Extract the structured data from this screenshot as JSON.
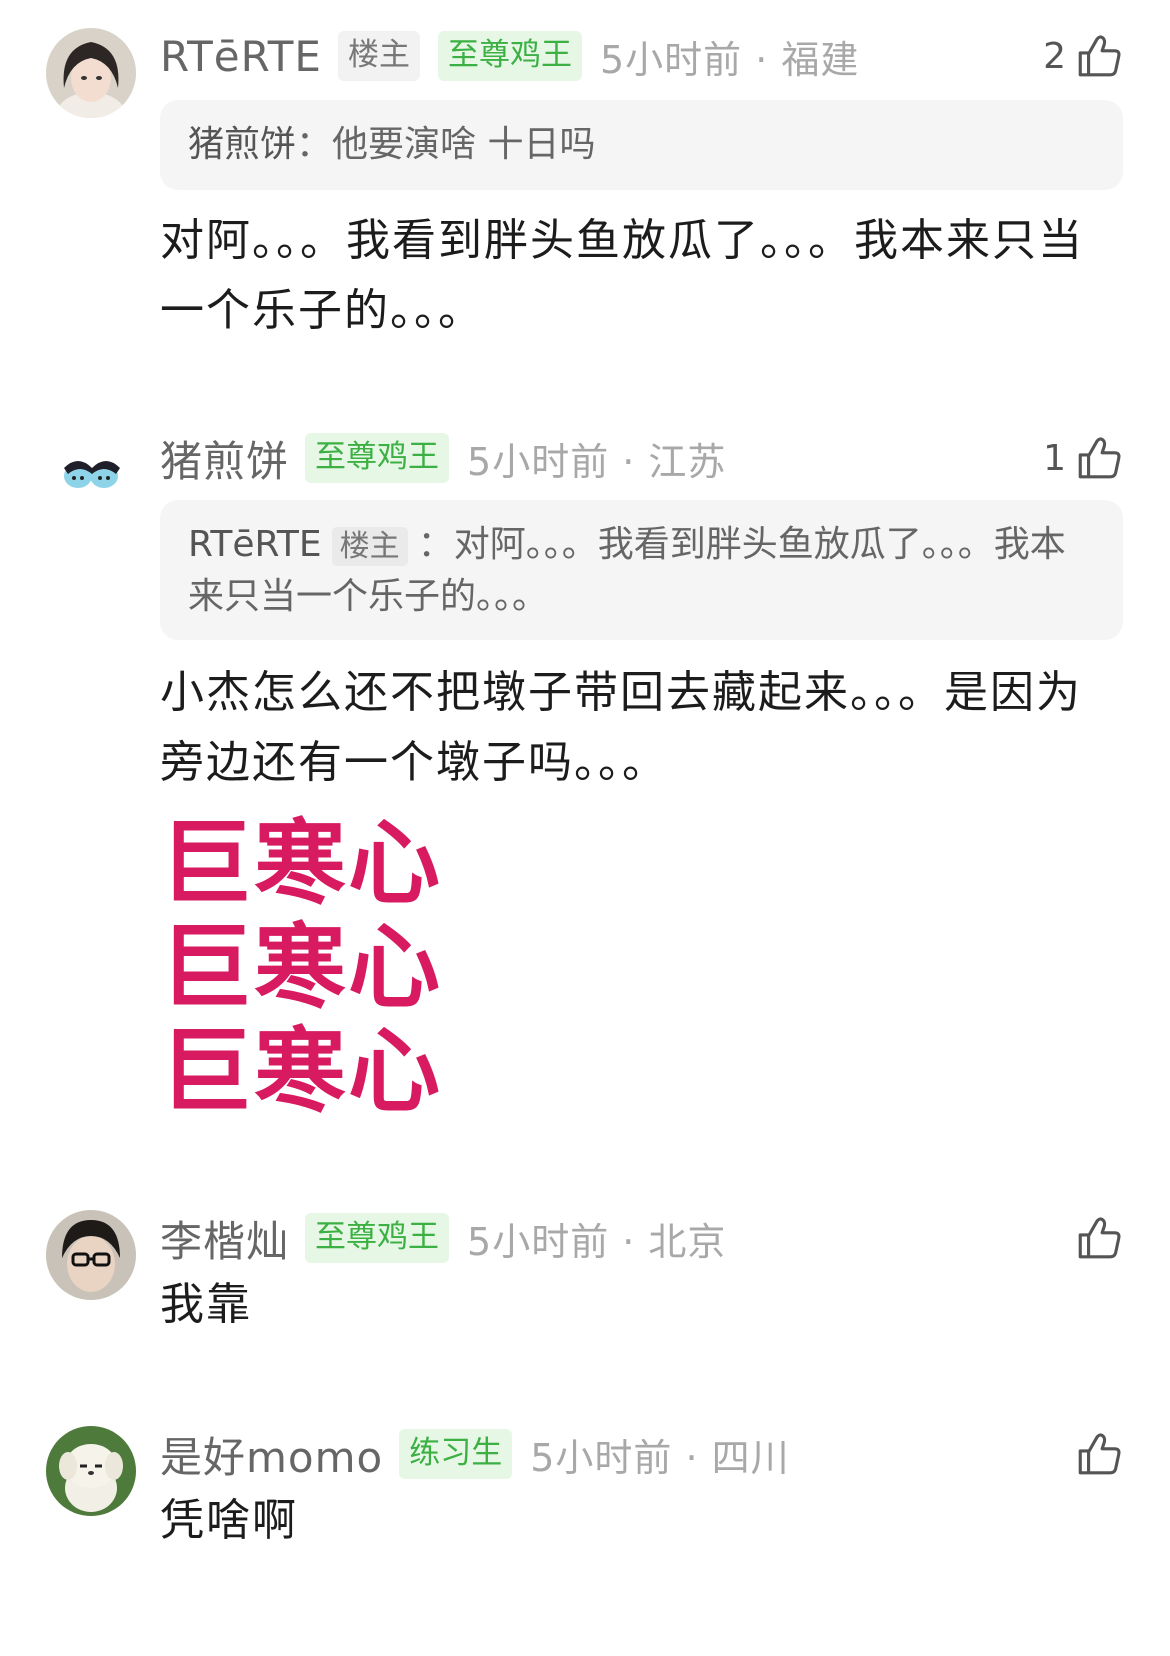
{
  "comments": [
    {
      "username": "RTēRTE",
      "owner_badge": "楼主",
      "badge": "至尊鸡王",
      "time_location": "5小时前 · 福建",
      "likes": "2",
      "quote": {
        "user": "猪煎饼",
        "separator": "：",
        "text": "他要演啥 十日吗"
      },
      "text": "对阿。。。我看到胖头鱼放瓜了。。。我本来只当一个乐子的。。。"
    },
    {
      "username": "猪煎饼",
      "badge": "至尊鸡王",
      "time_location": "5小时前 · 江苏",
      "likes": "1",
      "quote": {
        "user": "RTēRTE",
        "owner_badge": "楼主",
        "separator": "：",
        "text": "对阿。。。我看到胖头鱼放瓜了。。。我本来只当一个乐子的。。。"
      },
      "text": "小杰怎么还不把墩子带回去藏起来。。。是因为旁边还有一个墩子吗。。。",
      "sticker_lines": [
        "巨寒心",
        "巨寒心",
        "巨寒心"
      ]
    },
    {
      "username": "李楷灿",
      "badge": "至尊鸡王",
      "time_location": "5小时前 · 北京",
      "text": "我靠"
    },
    {
      "username": "是好momo",
      "badge": "练习生",
      "time_location": "5小时前 · 四川",
      "text": "凭啥啊"
    }
  ],
  "icons": {
    "like": "thumbs-up-icon"
  },
  "colors": {
    "badge_green": "#3cb043",
    "sticker_pink": "#d81b60"
  }
}
